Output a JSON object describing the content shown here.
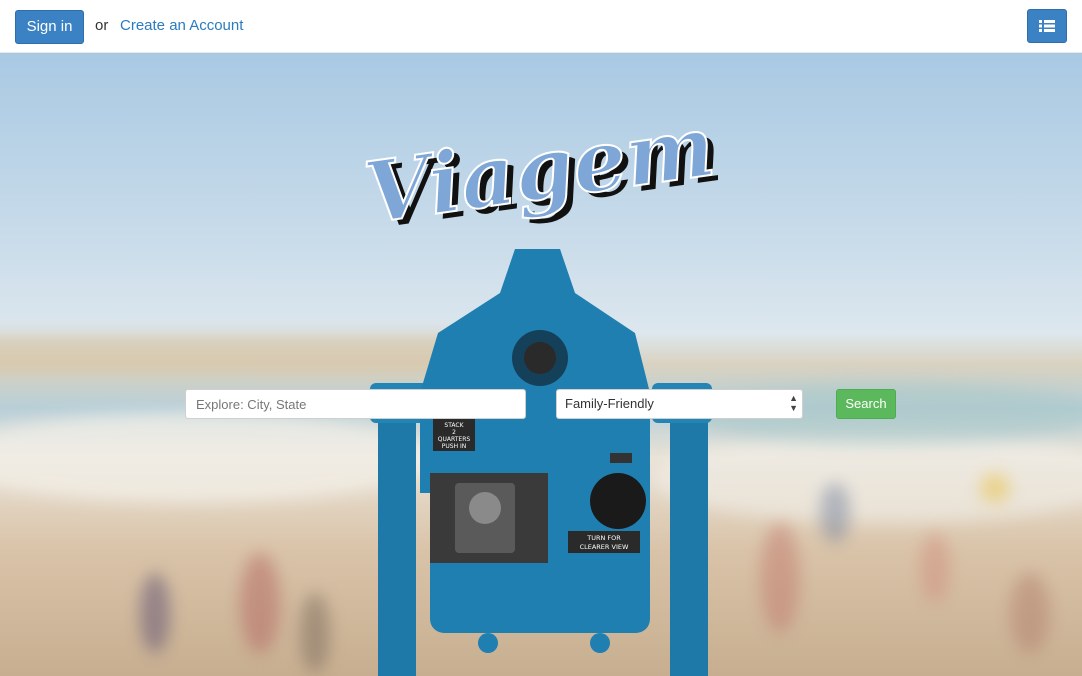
{
  "nav": {
    "signin_label": "Sign in",
    "or_text": "or",
    "create_account_label": "Create an Account",
    "menu_icon": "list-icon"
  },
  "hero": {
    "logo_text": "Viagem",
    "viewer_labels": {
      "stack": "STACK",
      "quarters": "2",
      "quarters_text": "QUARTERS",
      "push": "PUSH IN",
      "turn": "TURN FOR",
      "clearer": "CLEARER VIEW"
    }
  },
  "search": {
    "placeholder": "Explore: City, State",
    "value": "",
    "filter_selected": "Family-Friendly",
    "button_label": "Search"
  },
  "colors": {
    "primary": "#3b82c4",
    "link": "#2a7bbf",
    "success": "#5cb85c",
    "viewer": "#1e78a8",
    "logo": "#7ea6d6"
  }
}
